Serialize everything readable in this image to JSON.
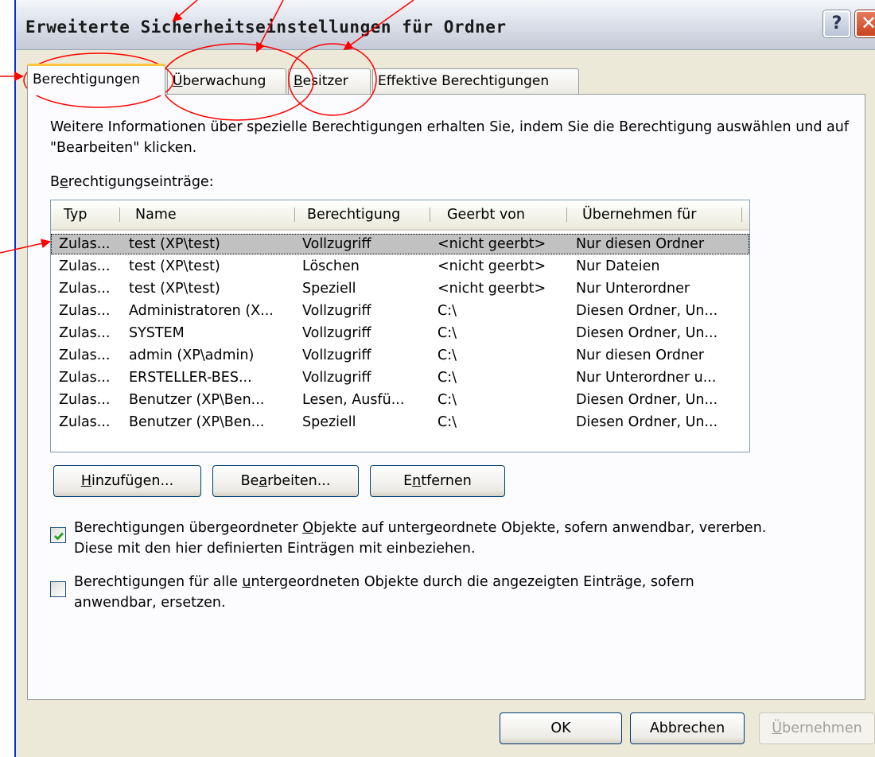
{
  "window": {
    "title": "Erweiterte Sicherheitseinstellungen für Ordner",
    "help_glyph": "?",
    "close_glyph": "✕"
  },
  "tabs": [
    {
      "label": "Berechtigungen",
      "active": true
    },
    {
      "pre": "",
      "u": "Ü",
      "post": "berwachung"
    },
    {
      "pre": "",
      "u": "B",
      "post": "esitzer"
    },
    {
      "label": "Effektive Berechtigungen"
    }
  ],
  "info": {
    "text": "Weitere Informationen über spezielle Berechtigungen erhalten Sie, indem Sie die Berechtigung auswählen und auf \"Bearbeiten\" klicken.",
    "entries_label_pre": "B",
    "entries_label_u": "e",
    "entries_label_post": "rechtigungseinträge:"
  },
  "list": {
    "columns": [
      "Typ",
      "Name",
      "Berechtigung",
      "Geerbt von",
      "Übernehmen für"
    ],
    "rows": [
      [
        "Zulas...",
        "test (XP\\test)",
        "Vollzugriff",
        "<nicht geerbt>",
        "Nur diesen Ordner"
      ],
      [
        "Zulas...",
        "test (XP\\test)",
        "Löschen",
        "<nicht geerbt>",
        "Nur Dateien"
      ],
      [
        "Zulas...",
        "test (XP\\test)",
        "Speziell",
        "<nicht geerbt>",
        "Nur Unterordner"
      ],
      [
        "Zulas...",
        "Administratoren (X...",
        "Vollzugriff",
        "C:\\",
        "Diesen Ordner, Un..."
      ],
      [
        "Zulas...",
        "SYSTEM",
        "Vollzugriff",
        "C:\\",
        "Diesen Ordner, Un..."
      ],
      [
        "Zulas...",
        "admin (XP\\admin)",
        "Vollzugriff",
        "C:\\",
        "Nur diesen Ordner"
      ],
      [
        "Zulas...",
        "ERSTELLER-BES...",
        "Vollzugriff",
        "C:\\",
        "Nur Unterordner u..."
      ],
      [
        "Zulas...",
        "Benutzer (XP\\Ben...",
        "Lesen, Ausfü...",
        "C:\\",
        "Diesen Ordner, Un..."
      ],
      [
        "Zulas...",
        "Benutzer (XP\\Ben...",
        "Speziell",
        "C:\\",
        "Diesen Ordner, Un..."
      ]
    ],
    "selected_row": 0
  },
  "buttons": {
    "add": {
      "u": "H",
      "post": "inzufügen..."
    },
    "edit": {
      "pre": "Be",
      "u": "a",
      "post": "rbeiten..."
    },
    "remove": {
      "pre": "E",
      "u": "n",
      "post": "tfernen"
    }
  },
  "checkboxes": {
    "inherit": {
      "checked": true,
      "pre": "Berechtigungen übergeordneter ",
      "u": "O",
      "post": "bjekte auf untergeordnete Objekte, sofern anwendbar, vererben.",
      "line2": "Diese mit den hier definierten Einträgen mit einbeziehen."
    },
    "replace": {
      "checked": false,
      "pre": "Berechtigungen für alle ",
      "u": "u",
      "post": "ntergeordneten Objekte durch die angezeigten Einträge, sofern",
      "line2": "anwendbar, ersetzen."
    }
  },
  "footer": {
    "ok": "OK",
    "cancel": "Abbrechen",
    "apply_u": "Ü",
    "apply_post": "bernehmen"
  },
  "colors": {
    "annotation": "#ff0000",
    "selected_row": "#c1c1c1",
    "checkmark": "#21a121"
  }
}
